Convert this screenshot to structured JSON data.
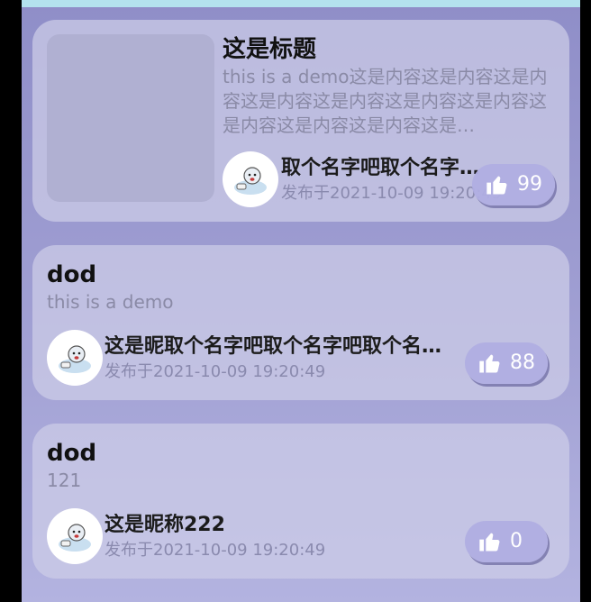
{
  "posts": [
    {
      "title": "这是标题",
      "content": "this is a demo这是内容这是内容这是内容这是内容这是内容这是内容这是内容这是内容这是内容这是内容这是…",
      "nickname": "取个名字吧取个名字…",
      "time": "发布于2021-10-09 19:20:49",
      "likes": "99",
      "has_image": true
    },
    {
      "title": "dod",
      "content": "this is a demo",
      "nickname": "这是昵取个名字吧取个名字吧取个名…",
      "time": "发布于2021-10-09 19:20:49",
      "likes": "88"
    },
    {
      "title": "dod",
      "content": "121",
      "nickname": "这是昵称222",
      "time": "发布于2021-10-09 19:20:49",
      "likes": "0"
    }
  ],
  "colors": {
    "top_bar": "#b4e2ee",
    "background_top": "#8f8ec8",
    "card": "#cdcde8",
    "like_button": "#b0aee2"
  },
  "icons": {
    "like": "thumbs-up-icon",
    "avatar": "cartoon-avatar"
  }
}
